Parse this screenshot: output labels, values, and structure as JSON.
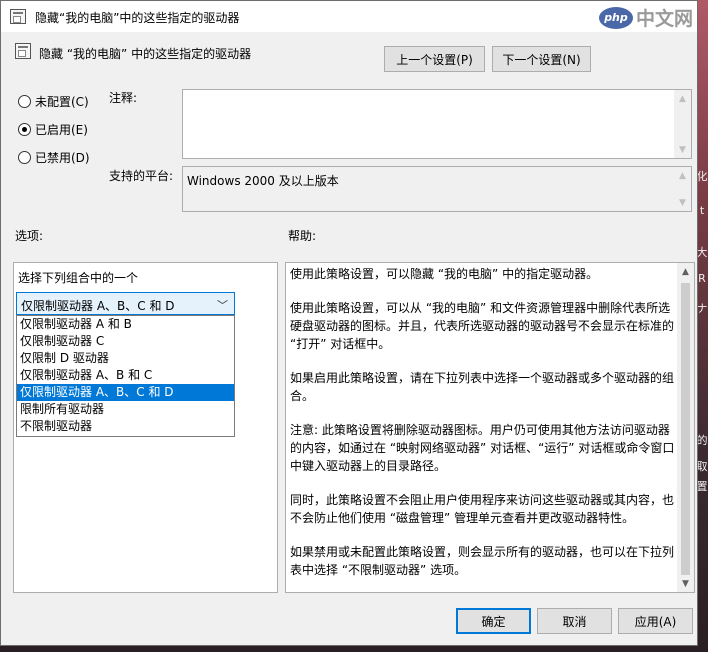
{
  "window": {
    "title": "隐藏“我的电脑”中的这些指定的驱动器"
  },
  "watermark": {
    "logo": "php",
    "text": "中文网"
  },
  "header": {
    "title": "隐藏 “我的电脑” 中的这些指定的驱动器",
    "prev_label": "上一个设置(P)",
    "next_label": "下一个设置(N)"
  },
  "state": {
    "options": [
      {
        "label": "未配置(C)",
        "checked": false
      },
      {
        "label": "已启用(E)",
        "checked": true
      },
      {
        "label": "已禁用(D)",
        "checked": false
      }
    ]
  },
  "comment": {
    "label": "注释:",
    "value": ""
  },
  "platform": {
    "label": "支持的平台:",
    "value": "Windows 2000 及以上版本"
  },
  "options_section": {
    "label": "选项:",
    "combo_label": "选择下列组合中的一个",
    "selected": "仅限制驱动器 A、B、C 和 D",
    "items": [
      "仅限制驱动器 A 和 B",
      "仅限制驱动器 C",
      "仅限制 D 驱动器",
      "仅限制驱动器 A、B 和 C",
      "仅限制驱动器 A、B、C 和 D",
      "限制所有驱动器",
      "不限制驱动器"
    ],
    "selected_index": 4
  },
  "help": {
    "label": "帮助:",
    "paragraphs": [
      "使用此策略设置，可以隐藏 “我的电脑” 中的指定驱动器。",
      "使用此策略设置，可以从 “我的电脑” 和文件资源管理器中删除代表所选硬盘驱动器的图标。并且，代表所选驱动器的驱动器号不会显示在标准的 “打开” 对话框中。",
      "如果启用此策略设置，请在下拉列表中选择一个驱动器或多个驱动器的组合。",
      "注意: 此策略设置将删除驱动器图标。用户仍可使用其他方法访问驱动器的内容，如通过在 “映射网络驱动器” 对话框、“运行” 对话框或命令窗口中键入驱动器上的目录路径。",
      "同时，此策略设置不会阻止用户使用程序来访问这些驱动器或其内容，也不会防止他们使用 “磁盘管理” 管理单元查看并更改驱动器特性。",
      "如果禁用或未配置此策略设置，则会显示所有的驱动器，也可以在下拉列表中选择 “不限制驱动器” 选项。"
    ]
  },
  "footer": {
    "ok": "确定",
    "cancel": "取消",
    "apply": "应用(A)"
  },
  "desktop_strip": [
    "化",
    "t",
    "大",
    "R",
    "ナ",
    "",
    "的",
    "取",
    "置"
  ]
}
